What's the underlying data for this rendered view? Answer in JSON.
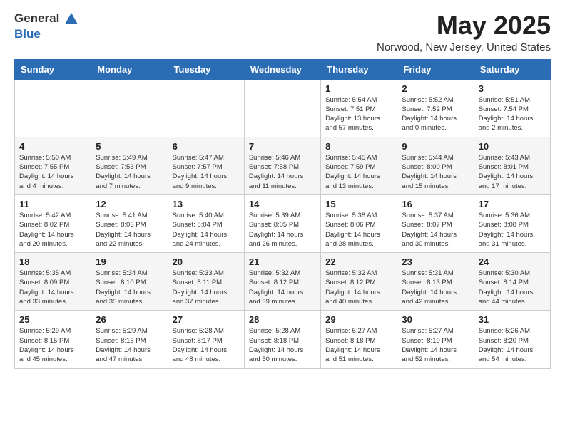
{
  "header": {
    "logo_general": "General",
    "logo_blue": "Blue",
    "month": "May 2025",
    "location": "Norwood, New Jersey, United States"
  },
  "weekdays": [
    "Sunday",
    "Monday",
    "Tuesday",
    "Wednesday",
    "Thursday",
    "Friday",
    "Saturday"
  ],
  "weeks": [
    [
      {
        "day": "",
        "info": ""
      },
      {
        "day": "",
        "info": ""
      },
      {
        "day": "",
        "info": ""
      },
      {
        "day": "",
        "info": ""
      },
      {
        "day": "1",
        "info": "Sunrise: 5:54 AM\nSunset: 7:51 PM\nDaylight: 13 hours\nand 57 minutes."
      },
      {
        "day": "2",
        "info": "Sunrise: 5:52 AM\nSunset: 7:52 PM\nDaylight: 14 hours\nand 0 minutes."
      },
      {
        "day": "3",
        "info": "Sunrise: 5:51 AM\nSunset: 7:54 PM\nDaylight: 14 hours\nand 2 minutes."
      }
    ],
    [
      {
        "day": "4",
        "info": "Sunrise: 5:50 AM\nSunset: 7:55 PM\nDaylight: 14 hours\nand 4 minutes."
      },
      {
        "day": "5",
        "info": "Sunrise: 5:49 AM\nSunset: 7:56 PM\nDaylight: 14 hours\nand 7 minutes."
      },
      {
        "day": "6",
        "info": "Sunrise: 5:47 AM\nSunset: 7:57 PM\nDaylight: 14 hours\nand 9 minutes."
      },
      {
        "day": "7",
        "info": "Sunrise: 5:46 AM\nSunset: 7:58 PM\nDaylight: 14 hours\nand 11 minutes."
      },
      {
        "day": "8",
        "info": "Sunrise: 5:45 AM\nSunset: 7:59 PM\nDaylight: 14 hours\nand 13 minutes."
      },
      {
        "day": "9",
        "info": "Sunrise: 5:44 AM\nSunset: 8:00 PM\nDaylight: 14 hours\nand 15 minutes."
      },
      {
        "day": "10",
        "info": "Sunrise: 5:43 AM\nSunset: 8:01 PM\nDaylight: 14 hours\nand 17 minutes."
      }
    ],
    [
      {
        "day": "11",
        "info": "Sunrise: 5:42 AM\nSunset: 8:02 PM\nDaylight: 14 hours\nand 20 minutes."
      },
      {
        "day": "12",
        "info": "Sunrise: 5:41 AM\nSunset: 8:03 PM\nDaylight: 14 hours\nand 22 minutes."
      },
      {
        "day": "13",
        "info": "Sunrise: 5:40 AM\nSunset: 8:04 PM\nDaylight: 14 hours\nand 24 minutes."
      },
      {
        "day": "14",
        "info": "Sunrise: 5:39 AM\nSunset: 8:05 PM\nDaylight: 14 hours\nand 26 minutes."
      },
      {
        "day": "15",
        "info": "Sunrise: 5:38 AM\nSunset: 8:06 PM\nDaylight: 14 hours\nand 28 minutes."
      },
      {
        "day": "16",
        "info": "Sunrise: 5:37 AM\nSunset: 8:07 PM\nDaylight: 14 hours\nand 30 minutes."
      },
      {
        "day": "17",
        "info": "Sunrise: 5:36 AM\nSunset: 8:08 PM\nDaylight: 14 hours\nand 31 minutes."
      }
    ],
    [
      {
        "day": "18",
        "info": "Sunrise: 5:35 AM\nSunset: 8:09 PM\nDaylight: 14 hours\nand 33 minutes."
      },
      {
        "day": "19",
        "info": "Sunrise: 5:34 AM\nSunset: 8:10 PM\nDaylight: 14 hours\nand 35 minutes."
      },
      {
        "day": "20",
        "info": "Sunrise: 5:33 AM\nSunset: 8:11 PM\nDaylight: 14 hours\nand 37 minutes."
      },
      {
        "day": "21",
        "info": "Sunrise: 5:32 AM\nSunset: 8:12 PM\nDaylight: 14 hours\nand 39 minutes."
      },
      {
        "day": "22",
        "info": "Sunrise: 5:32 AM\nSunset: 8:12 PM\nDaylight: 14 hours\nand 40 minutes."
      },
      {
        "day": "23",
        "info": "Sunrise: 5:31 AM\nSunset: 8:13 PM\nDaylight: 14 hours\nand 42 minutes."
      },
      {
        "day": "24",
        "info": "Sunrise: 5:30 AM\nSunset: 8:14 PM\nDaylight: 14 hours\nand 44 minutes."
      }
    ],
    [
      {
        "day": "25",
        "info": "Sunrise: 5:29 AM\nSunset: 8:15 PM\nDaylight: 14 hours\nand 45 minutes."
      },
      {
        "day": "26",
        "info": "Sunrise: 5:29 AM\nSunset: 8:16 PM\nDaylight: 14 hours\nand 47 minutes."
      },
      {
        "day": "27",
        "info": "Sunrise: 5:28 AM\nSunset: 8:17 PM\nDaylight: 14 hours\nand 48 minutes."
      },
      {
        "day": "28",
        "info": "Sunrise: 5:28 AM\nSunset: 8:18 PM\nDaylight: 14 hours\nand 50 minutes."
      },
      {
        "day": "29",
        "info": "Sunrise: 5:27 AM\nSunset: 8:18 PM\nDaylight: 14 hours\nand 51 minutes."
      },
      {
        "day": "30",
        "info": "Sunrise: 5:27 AM\nSunset: 8:19 PM\nDaylight: 14 hours\nand 52 minutes."
      },
      {
        "day": "31",
        "info": "Sunrise: 5:26 AM\nSunset: 8:20 PM\nDaylight: 14 hours\nand 54 minutes."
      }
    ]
  ]
}
